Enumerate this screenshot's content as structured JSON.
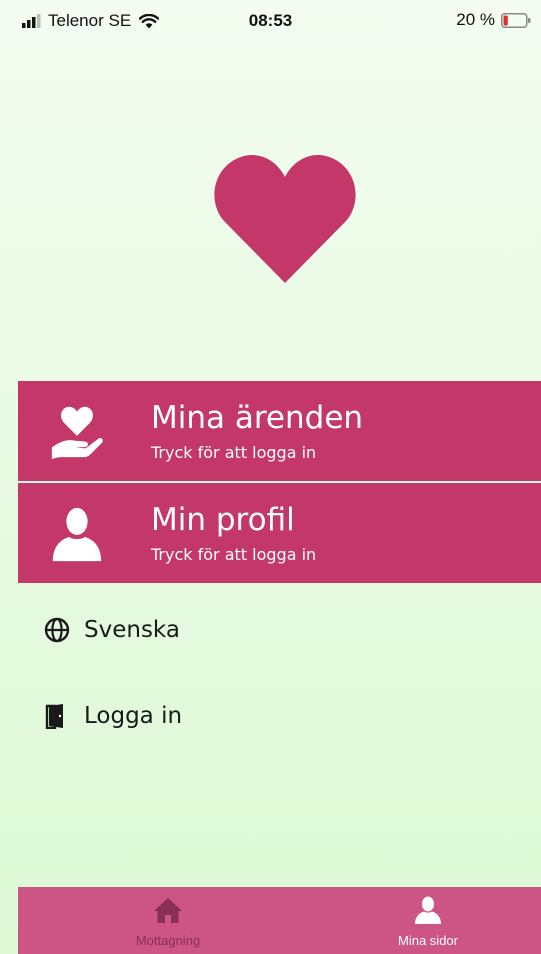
{
  "status_bar": {
    "carrier": "Telenor SE",
    "time": "08:53",
    "battery": "20 %",
    "battery_level": 0.2
  },
  "menu": {
    "cases": {
      "title": "Mina ärenden",
      "subtitle": "Tryck för att logga in",
      "icon": "hand-heart-icon"
    },
    "profile": {
      "title": "Min profil",
      "subtitle": "Tryck för att logga in",
      "icon": "person-icon"
    }
  },
  "options": {
    "language": {
      "label": "Svenska",
      "icon": "globe-icon"
    },
    "login": {
      "label": "Logga in",
      "icon": "door-icon"
    }
  },
  "tab_bar": {
    "tabs": [
      {
        "label": "Mottagning",
        "icon": "home-icon",
        "active": false
      },
      {
        "label": "Mina sidor",
        "icon": "person-icon",
        "active": true
      }
    ]
  },
  "colors": {
    "accent": "#c33868",
    "tab_bar": "#cc5585",
    "background": "#e9fbe4",
    "battery_low": "#e0302a"
  }
}
